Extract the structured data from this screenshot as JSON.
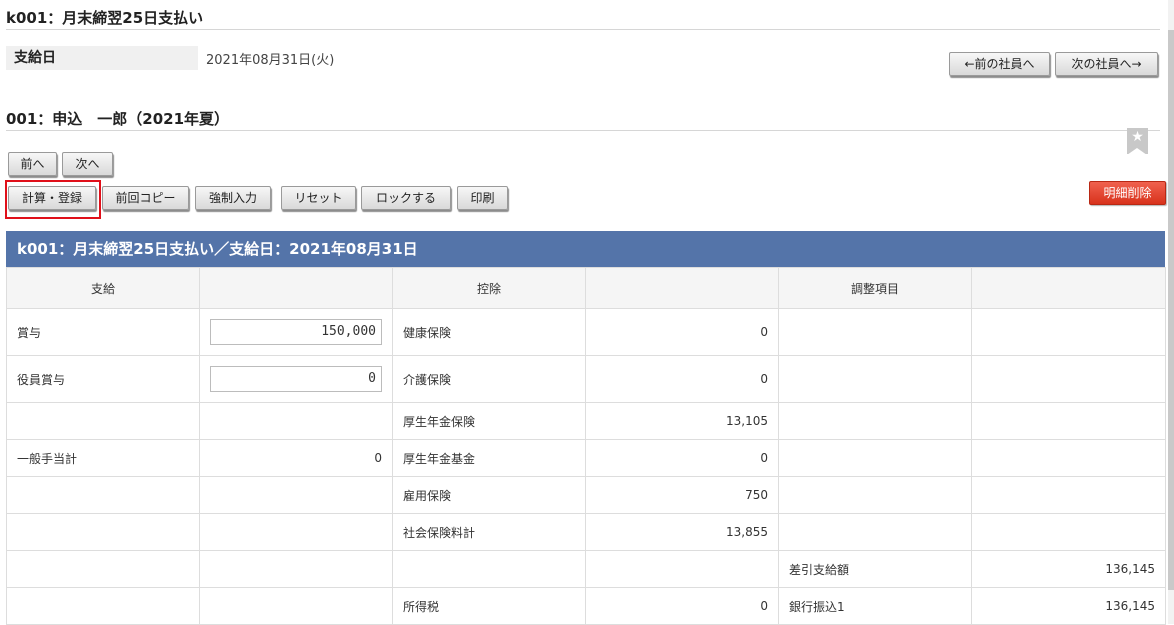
{
  "header": {
    "title": "k001：月末締翌25日支払い"
  },
  "payday": {
    "label": "支給日",
    "value": "2021年08月31日(火)"
  },
  "nav": {
    "prev_employee": "←前の社員へ",
    "next_employee": "次の社員へ→"
  },
  "employee": {
    "name": "001：申込　一郎（2021年夏）"
  },
  "toolbar": {
    "prev": "前へ",
    "next": "次へ",
    "calc_register": "計算・登録",
    "copy_previous": "前回コピー",
    "forced_input": "強制入力",
    "reset": "リセット",
    "lock": "ロックする",
    "print": "印刷",
    "delete_detail": "明細削除"
  },
  "banner": {
    "title": "k001：月末締翌25日支払い／支給日：2021年08月31日"
  },
  "table": {
    "headers": {
      "payment": "支給",
      "deduction": "控除",
      "adjustment": "調整項目"
    },
    "rows": [
      {
        "pay_label": "賞与",
        "pay_value": "150,000",
        "pay_input": true,
        "ded_label": "健康保険",
        "ded_value": "0",
        "adj_label": "",
        "adj_value": ""
      },
      {
        "pay_label": "役員賞与",
        "pay_value": "0",
        "pay_input": true,
        "ded_label": "介護保険",
        "ded_value": "0",
        "adj_label": "",
        "adj_value": ""
      },
      {
        "pay_label": "",
        "pay_value": "",
        "pay_input": false,
        "ded_label": "厚生年金保険",
        "ded_value": "13,105",
        "adj_label": "",
        "adj_value": ""
      },
      {
        "pay_label": "一般手当計",
        "pay_value": "0",
        "pay_input": false,
        "ded_label": "厚生年金基金",
        "ded_value": "0",
        "adj_label": "",
        "adj_value": ""
      },
      {
        "pay_label": "",
        "pay_value": "",
        "pay_input": false,
        "ded_label": "雇用保険",
        "ded_value": "750",
        "adj_label": "",
        "adj_value": ""
      },
      {
        "pay_label": "",
        "pay_value": "",
        "pay_input": false,
        "ded_label": "社会保険料計",
        "ded_value": "13,855",
        "adj_label": "",
        "adj_value": ""
      },
      {
        "pay_label": "",
        "pay_value": "",
        "pay_input": false,
        "ded_label": "",
        "ded_value": "",
        "adj_label": "差引支給額",
        "adj_value": "136,145"
      },
      {
        "pay_label": "",
        "pay_value": "",
        "pay_input": false,
        "ded_label": "所得税",
        "ded_value": "0",
        "adj_label": "銀行振込1",
        "adj_value": "136,145"
      }
    ]
  },
  "colors": {
    "banner": "#5474a9",
    "delete_button": "#e03c28",
    "highlight_border": "#e0101a"
  }
}
